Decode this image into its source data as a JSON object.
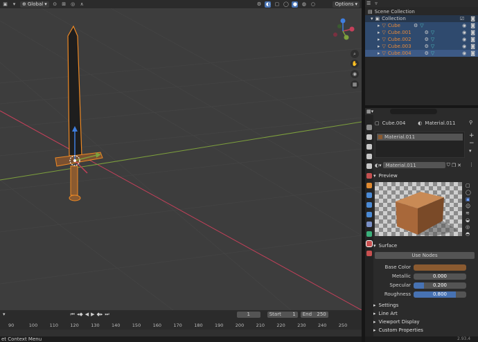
{
  "viewport_header": {
    "transform_orientation": "Global",
    "options_label": "Options"
  },
  "outliner": {
    "scene_collection": "Scene Collection",
    "collection": "Collection",
    "items": [
      "Cube",
      "Cube.001",
      "Cube.002",
      "Cube.003",
      "Cube.004"
    ]
  },
  "properties": {
    "object_name": "Cube.004",
    "material_name": "Material.011",
    "slot_name": "Material.011",
    "material_field": "Material.011",
    "preview_label": "Preview",
    "surface_label": "Surface",
    "use_nodes_label": "Use Nodes",
    "fields": [
      {
        "label": "Base Color",
        "value": ""
      },
      {
        "label": "Metallic",
        "value": "0.000",
        "fill": 0.0
      },
      {
        "label": "Specular",
        "value": "0.200",
        "fill": 0.2
      },
      {
        "label": "Roughness",
        "value": "0.800",
        "fill": 0.8
      }
    ],
    "collapsed_sections": [
      "Settings",
      "Line Art",
      "Viewport Display",
      "Custom Properties"
    ],
    "base_color_hex": "#8a5a30"
  },
  "timeline": {
    "current_frame": "1",
    "start_label": "Start",
    "start_value": "1",
    "end_label": "End",
    "end_value": "250",
    "ticks": [
      "90",
      "100",
      "110",
      "120",
      "130",
      "140",
      "150",
      "160",
      "170",
      "180",
      "190",
      "200",
      "210",
      "220",
      "230",
      "240",
      "250"
    ]
  },
  "status_bar": {
    "left_text": "et Context Menu",
    "version": "2.93.4"
  },
  "colors": {
    "selection_orange": "#f08a24",
    "x_axis": "#c4405a",
    "y_axis": "#7ea13d",
    "active_blue": "#3d5a86"
  }
}
